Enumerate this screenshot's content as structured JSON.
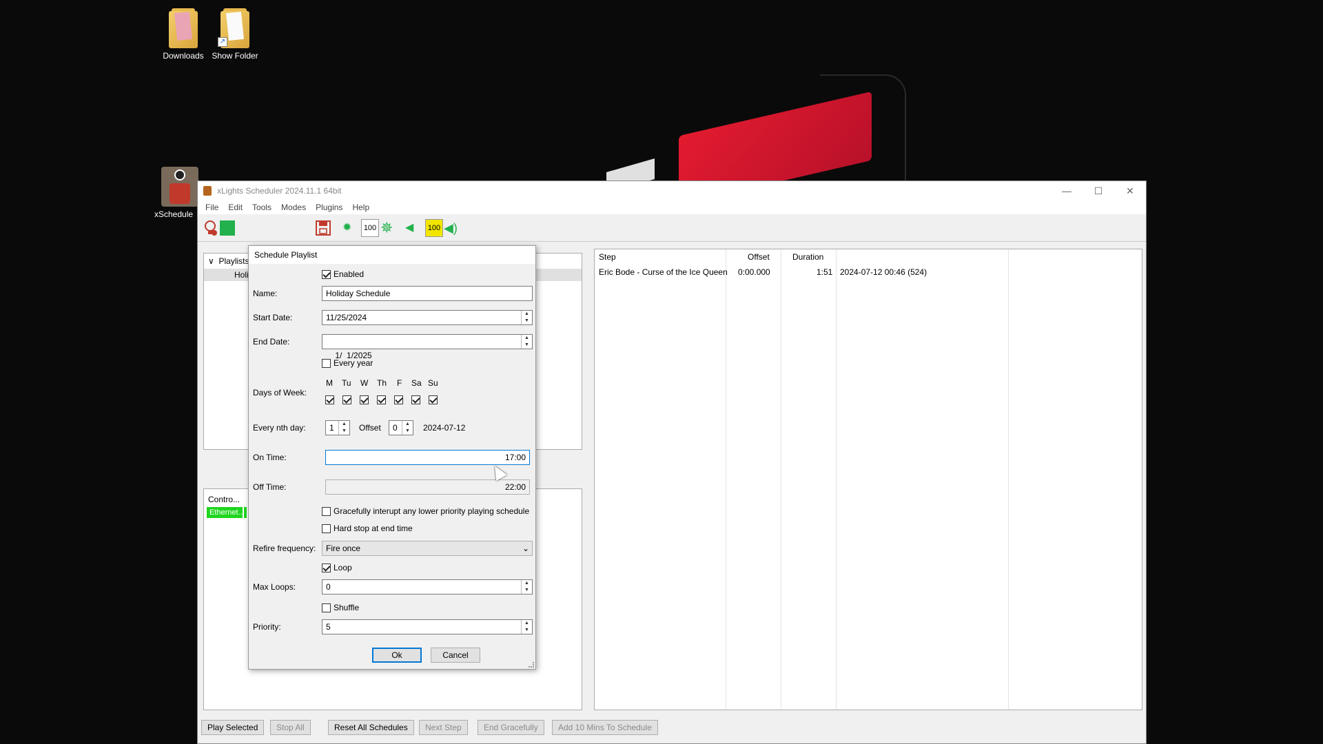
{
  "desktop": {
    "icons": [
      {
        "label": "Downloads"
      },
      {
        "label": "Show Folder"
      },
      {
        "label": "xSchedule"
      }
    ]
  },
  "window": {
    "title": "xLights Scheduler 2024.11.1 64bit",
    "menu": [
      "File",
      "Edit",
      "Tools",
      "Modes",
      "Plugins",
      "Help"
    ],
    "toolbar": {
      "brightness_value": "100",
      "volume_value": "100"
    },
    "left_top_panel": {
      "tree_root": "Playlists",
      "tree_child": "Holi"
    },
    "left_bottom_panel": {
      "header": "Contro...",
      "ethernet_label": "Ethernet..."
    },
    "steps_grid": {
      "headers": [
        "Step",
        "Offset",
        "Duration"
      ],
      "rows": [
        {
          "step": "Eric Bode - Curse of the Ice Queen",
          "offset": "0:00.000",
          "duration": "1:51",
          "extra": "2024-07-12 00:46 (524)"
        }
      ]
    },
    "bottom_buttons": [
      {
        "label": "Play Selected",
        "enabled": true
      },
      {
        "label": "Stop All",
        "enabled": false
      },
      {
        "label": "Reset All Schedules",
        "enabled": true
      },
      {
        "label": "Next Step",
        "enabled": false
      },
      {
        "label": "End Gracefully",
        "enabled": false
      },
      {
        "label": "Add 10 Mins To Schedule",
        "enabled": false
      }
    ]
  },
  "dialog": {
    "title": "Schedule Playlist",
    "enabled_label": "Enabled",
    "name_label": "Name:",
    "name_value": "Holiday Schedule",
    "start_date_label": "Start Date:",
    "start_date_value": "11/25/2024",
    "end_date_label": "End Date:",
    "end_date_value": "1/  1/2025",
    "every_year_label": "Every year",
    "days_of_week_label": "Days of Week:",
    "days": [
      "M",
      "Tu",
      "W",
      "Th",
      "F",
      "Sa",
      "Su"
    ],
    "every_nth_label": "Every nth day:",
    "every_nth_value": "1",
    "offset_label": "Offset",
    "offset_value": "0",
    "nth_date": "2024-07-12",
    "on_time_label": "On Time:",
    "on_time_value": "17:00",
    "off_time_label": "Off Time:",
    "off_time_value": "22:00",
    "graceful_label": "Gracefully interupt any lower priority playing schedule",
    "hard_stop_label": "Hard stop at end time",
    "refire_label": "Refire frequency:",
    "refire_value": "Fire once",
    "loop_label": "Loop",
    "max_loops_label": "Max Loops:",
    "max_loops_value": "0",
    "shuffle_label": "Shuffle",
    "priority_label": "Priority:",
    "priority_value": "5",
    "ok_label": "Ok",
    "cancel_label": "Cancel"
  }
}
